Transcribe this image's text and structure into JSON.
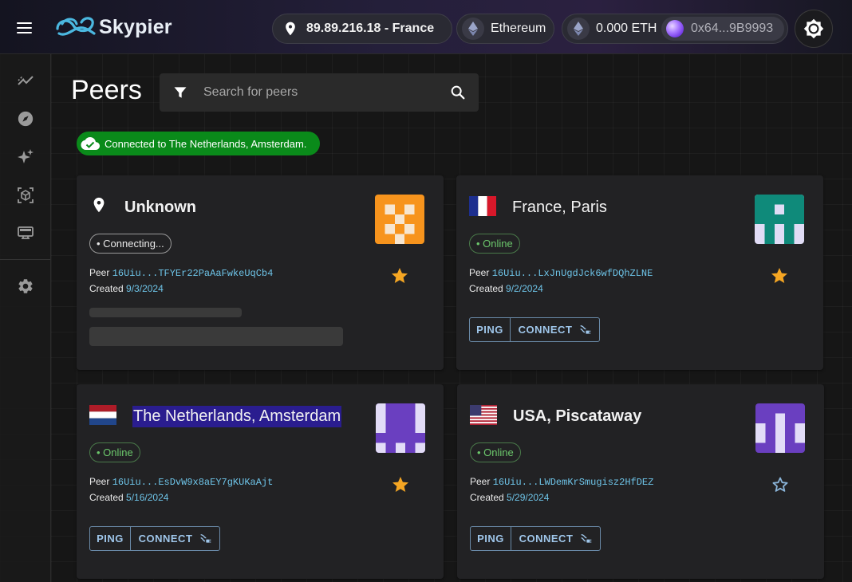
{
  "app": {
    "brand": "Skypier"
  },
  "header": {
    "location": "89.89.216.18 - France",
    "network": "Ethereum",
    "balance": "0.000 ETH",
    "wallet": "0x64...9B9993"
  },
  "main": {
    "title": "Peers",
    "search_placeholder": "Search for peers",
    "status": "Connected to The Netherlands, Amsterdam."
  },
  "labels": {
    "peer": "Peer",
    "created": "Created",
    "ping": "PING",
    "connect": "CONNECT"
  },
  "peers": [
    {
      "location": "Unknown",
      "status": "• Connecting...",
      "peer_id": "16Uiu...TFYEr22PaAaFwkeUqCb4",
      "created": "9/3/2024",
      "favorite": true,
      "avatar_color": "#f7941d",
      "avatar_bg": "#ffffff"
    },
    {
      "location": "France, Paris",
      "status": "• Online",
      "peer_id": "16Uiu...LxJnUgdJck6wfDQhZLNE",
      "created": "9/2/2024",
      "favorite": true,
      "avatar_color": "#0f8a7a",
      "avatar_bg": "#e0dcf5"
    },
    {
      "location": "The Netherlands, Amsterdam",
      "status": "• Online",
      "peer_id": "16Uiu...EsDvW9x8aEY7gKUKaAjt",
      "created": "5/16/2024",
      "favorite": true,
      "avatar_color": "#6a3fc0",
      "avatar_bg": "#e2dcf7"
    },
    {
      "location": "USA, Piscataway",
      "status": "• Online",
      "peer_id": "16Uiu...LWDemKrSmugisz2HfDEZ",
      "created": "5/29/2024",
      "favorite": false,
      "avatar_color": "#6a3fc0",
      "avatar_bg": "#e2dcf7"
    }
  ],
  "colors": {
    "accent": "#6ec4e8",
    "star_active": "#f5a623",
    "star_inactive": "#8ab4d8",
    "status_green": "#0a8a1a",
    "selection": "#2a1d8f"
  }
}
